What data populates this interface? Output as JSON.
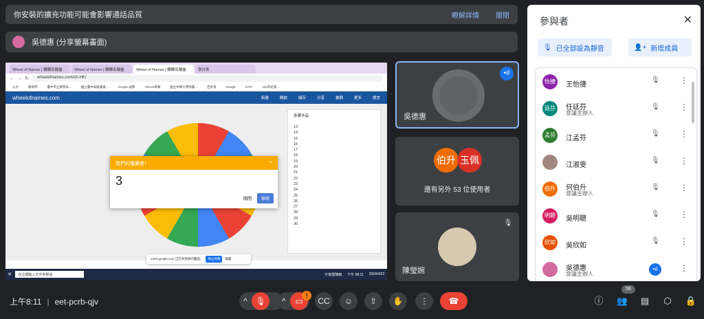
{
  "banner": {
    "message": "你安裝的擴充功能可能會影響通話品質",
    "learn_more": "瞭解詳情",
    "close": "關閉"
  },
  "presenter": {
    "label": "吳德惠 (分享螢幕畫面)"
  },
  "shared_screen": {
    "tabs": [
      "Wheel of Names | 轉轉名輪盤",
      "Wheel of Names | 轉轉名輪盤",
      "Wheel of Names | 轉轉名輪盤",
      "學分表"
    ],
    "address": "wheelofnames.com/zh-HK/",
    "bookmarks": [
      "公文",
      "教育學",
      "臺中市立東勢高...",
      "國立臺中高級農業...",
      "Google 試算",
      "Yahoo!奇摩",
      "國立中興大學附屬...",
      "百步夜",
      "Google",
      "ICRT",
      "102年結束..."
    ],
    "site_name": "wheelofnames.com",
    "site_menu": [
      "新建",
      "開啟",
      "儲存",
      "分享",
      "畫廊",
      "更多",
      "語言"
    ],
    "popup_title": "我們的獲勝者！",
    "popup_close": "×",
    "winner": "3",
    "btn_close": "關閉",
    "btn_remove": "移除",
    "entries_header": "參賽作品",
    "entries": [
      "13",
      "14",
      "15",
      "16",
      "17",
      "18",
      "19",
      "20",
      "21",
      "22",
      "23",
      "24",
      "25",
      "26",
      "27",
      "28",
      "29",
      "30"
    ],
    "sharing_msg": "meet.google.com 正在共用你的畫面。",
    "stop_sharing": "停止共用",
    "hide": "隱藏",
    "taskbar_search": "在這裡輸入文字來搜尋",
    "taskbar_weather": "午後雷陣雨",
    "taskbar_time": "下午 08:11",
    "taskbar_date": "2024/4/23"
  },
  "tiles": [
    {
      "name": "吳德惠"
    },
    {
      "a1": "伯升",
      "a2": "玉佩",
      "others": "還有另外 53 位使用者"
    },
    {
      "name": "陳瑩婉"
    }
  ],
  "panel": {
    "title": "參與者",
    "mute_all": "已全部設為靜音",
    "add_people": "新增成員",
    "people": [
      {
        "initials": "怡捷",
        "name": "王怡捷",
        "sub": "",
        "color": "#8e24aa"
      },
      {
        "initials": "廷芬",
        "name": "任廷芬",
        "sub": "會議主辦人",
        "color": "#00897b"
      },
      {
        "initials": "孟芬",
        "name": "江孟芬",
        "sub": "",
        "color": "#2e7d32"
      },
      {
        "initials": "",
        "name": "江淑雯",
        "sub": "",
        "color": "#a1887f"
      },
      {
        "initials": "伯升",
        "name": "何伯升",
        "sub": "會議主辦人",
        "color": "#ef6c00"
      },
      {
        "initials": "明聰",
        "name": "吳明聰",
        "sub": "",
        "color": "#d81b60"
      },
      {
        "initials": "欣如",
        "name": "吳欣如",
        "sub": "",
        "color": "#e65100"
      },
      {
        "initials": "",
        "name": "吳德惠",
        "sub": "會議主辦人",
        "color": "#d36aa0"
      }
    ]
  },
  "bottom": {
    "time": "上午8:11",
    "code": "eet-pcrb-qjv",
    "participants_count": "56",
    "warning": "!"
  },
  "colors": {
    "accent": "#8ab4f8",
    "end_call": "#ea4335",
    "background": "#202124"
  }
}
